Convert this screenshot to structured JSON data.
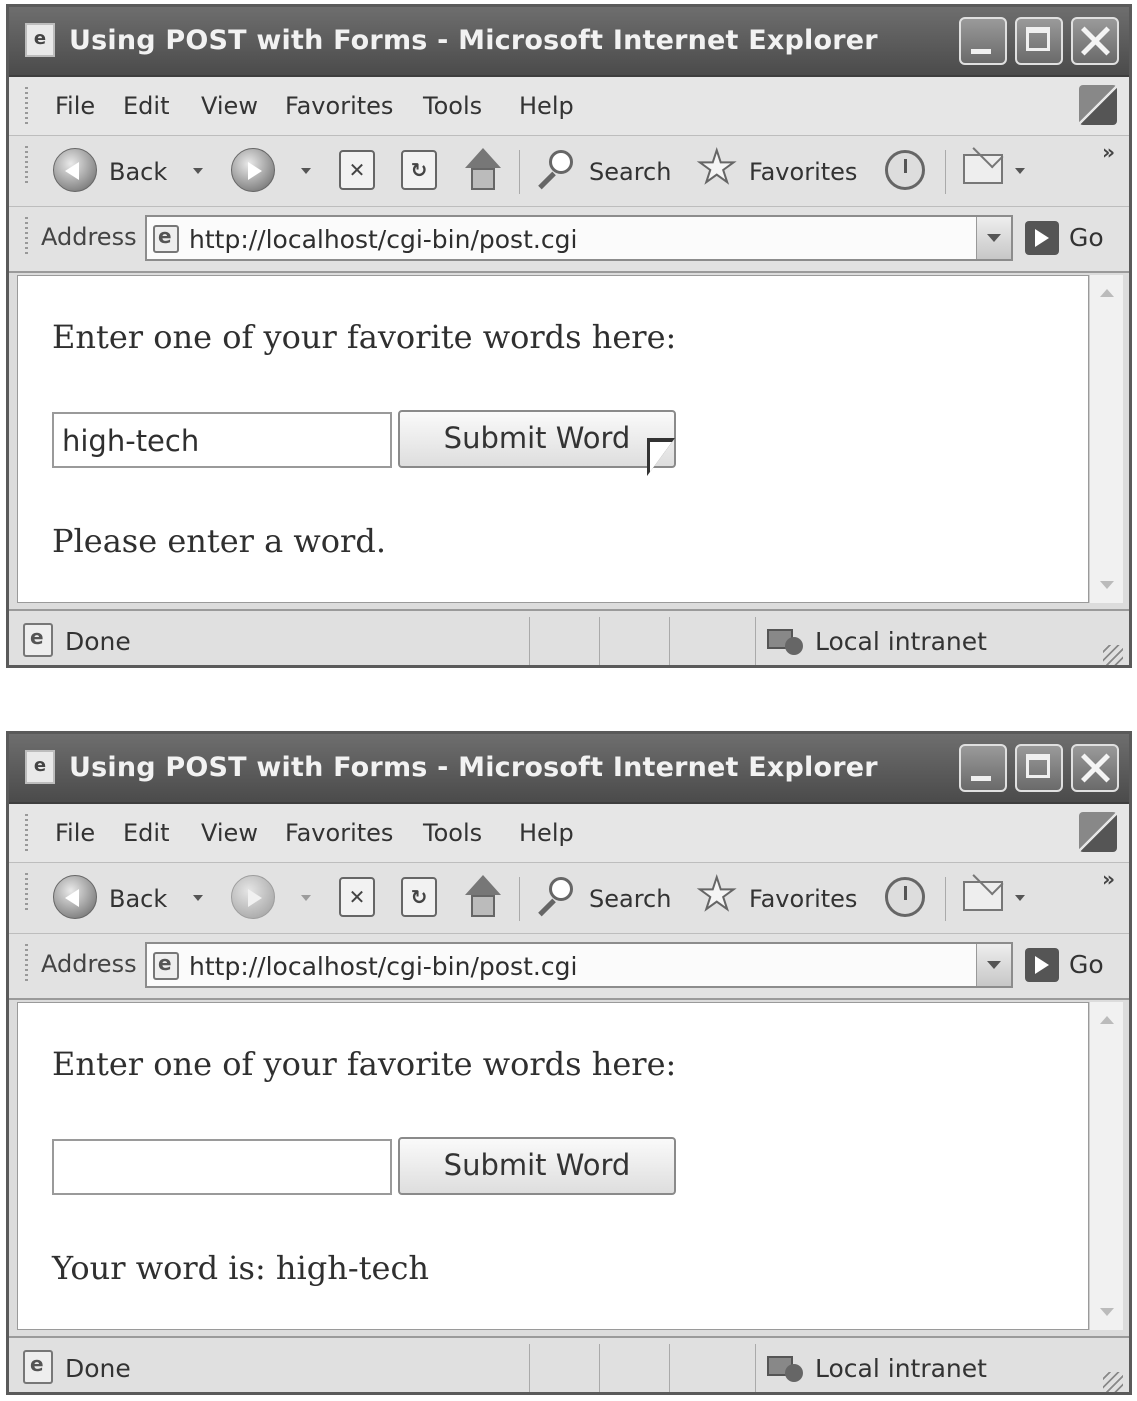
{
  "windows": [
    {
      "title": "Using POST with Forms - Microsoft Internet Explorer",
      "menu": [
        "File",
        "Edit",
        "View",
        "Favorites",
        "Tools",
        "Help"
      ],
      "toolbar": {
        "back_label": "Back",
        "search_label": "Search",
        "favorites_label": "Favorites",
        "more": "»"
      },
      "address": {
        "label": "Address",
        "url": "http://localhost/cgi-bin/post.cgi",
        "go_label": "Go"
      },
      "page": {
        "prompt": "Enter one of your favorite words here:",
        "input_value": "high-tech",
        "submit_label": "Submit Word",
        "message": "Please enter a word."
      },
      "status": {
        "text": "Done",
        "zone": "Local intranet"
      }
    },
    {
      "title": "Using POST with Forms - Microsoft Internet Explorer",
      "menu": [
        "File",
        "Edit",
        "View",
        "Favorites",
        "Tools",
        "Help"
      ],
      "toolbar": {
        "back_label": "Back",
        "search_label": "Search",
        "favorites_label": "Favorites",
        "more": "»"
      },
      "address": {
        "label": "Address",
        "url": "http://localhost/cgi-bin/post.cgi",
        "go_label": "Go"
      },
      "page": {
        "prompt": "Enter one of your favorite words here:",
        "input_value": "",
        "submit_label": "Submit Word",
        "message": "Your word is: high-tech"
      },
      "status": {
        "text": "Done",
        "zone": "Local intranet"
      }
    }
  ]
}
